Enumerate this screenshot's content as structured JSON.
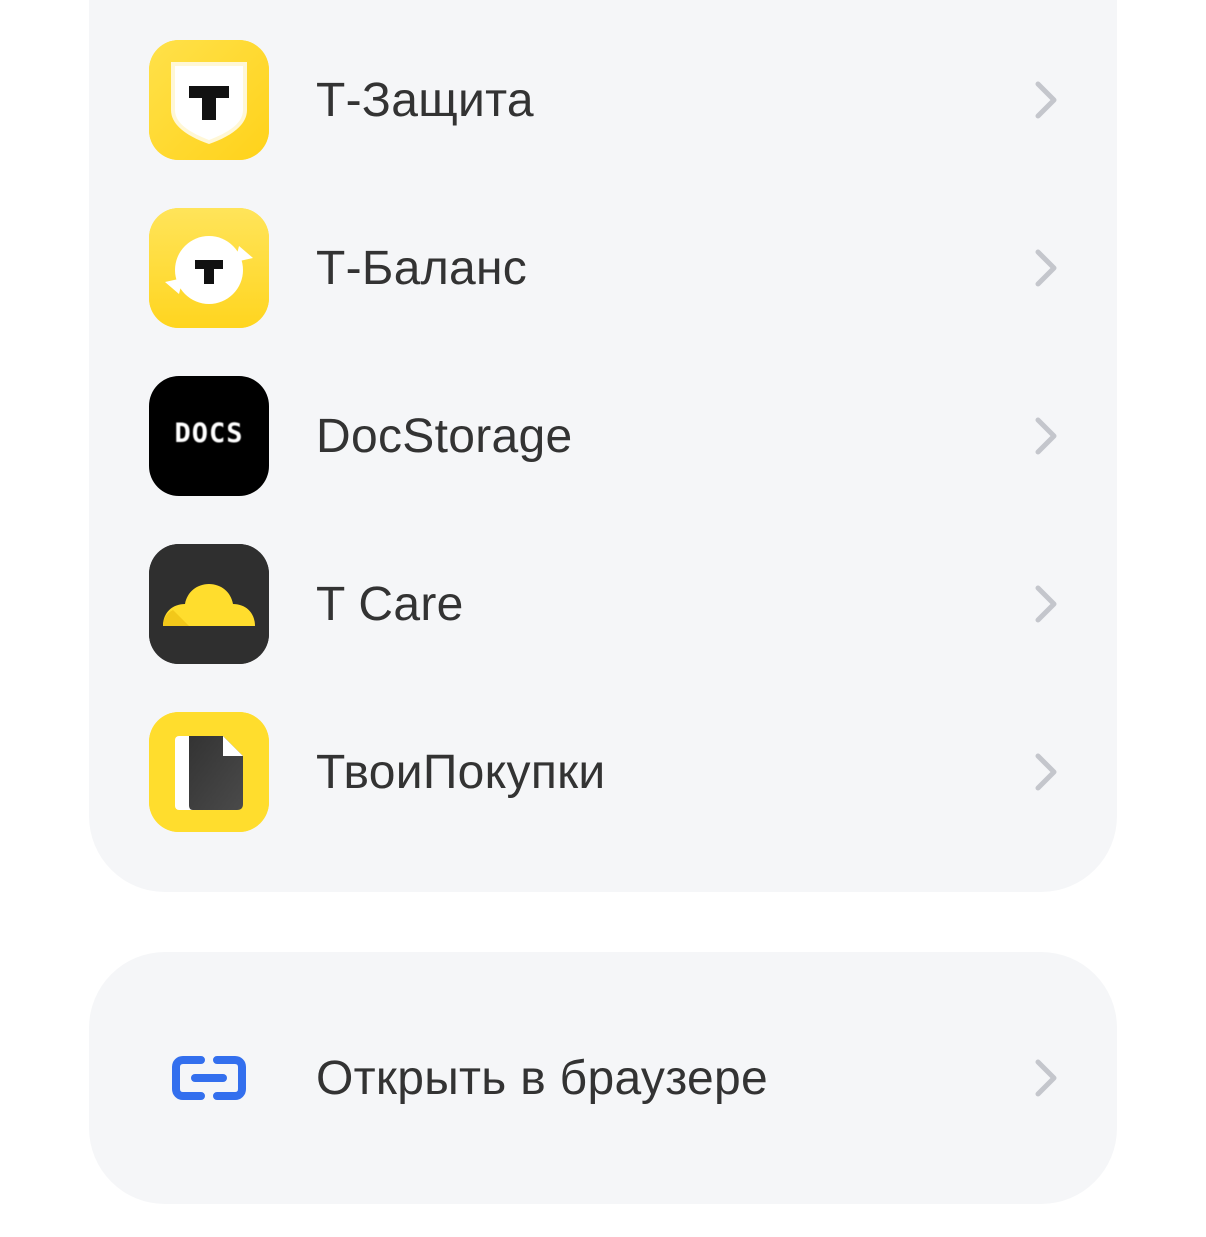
{
  "apps": [
    {
      "label": "Т-Защита",
      "icon": "shield-t-icon"
    },
    {
      "label": "Т-Баланс",
      "icon": "coin-t-icon"
    },
    {
      "label": "DocStorage",
      "icon": "docs-icon",
      "icon_text": "DOCS"
    },
    {
      "label": "T Care",
      "icon": "cloud-icon"
    },
    {
      "label": "ТвоиПокупки",
      "icon": "receipt-icon"
    }
  ],
  "browser": {
    "label": "Открыть в браузере",
    "icon": "link-icon"
  },
  "colors": {
    "card_bg": "#f5f6f8",
    "brand_yellow": "#ffdd2d",
    "link_blue": "#336fee",
    "text": "#333333",
    "chevron": "#c4c6cc"
  }
}
